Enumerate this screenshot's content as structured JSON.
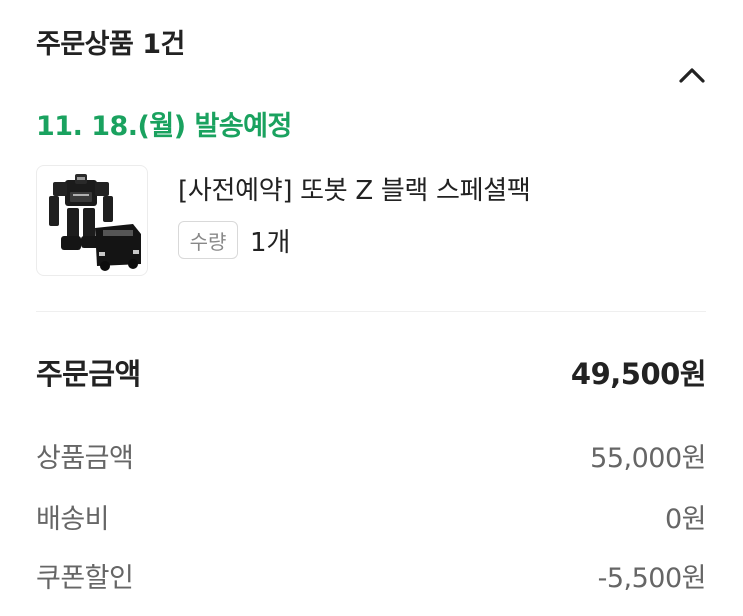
{
  "header": {
    "title": "주문상품 1건"
  },
  "shipping": {
    "date_label": "11. 18.(월) 발송예정"
  },
  "product": {
    "name": "[사전예약] 또봇 Z 블랙 스페셜팩",
    "qty_label": "수량",
    "qty_value": "1개"
  },
  "summary": {
    "total_label": "주문금액",
    "total_value": "49,500원",
    "rows": [
      {
        "label": "상품금액",
        "value": "55,000원"
      },
      {
        "label": "배송비",
        "value": "0원"
      },
      {
        "label": "쿠폰할인",
        "value": "-5,500원"
      }
    ]
  },
  "colors": {
    "accent_green": "#1aa25f",
    "text_dark": "#222222",
    "text_muted": "#666666"
  }
}
